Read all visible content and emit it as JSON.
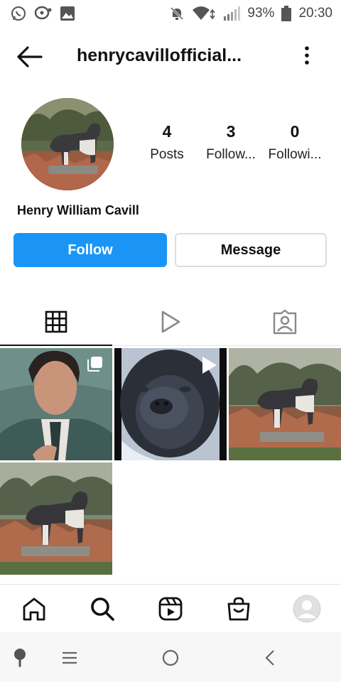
{
  "status_bar": {
    "battery": "93%",
    "time": "20:30",
    "left_icons": [
      "whatsapp-icon",
      "chat-bubble-icon",
      "image-icon"
    ],
    "right_icons": [
      "notifications-off-icon",
      "wifi-icon",
      "signal-icon",
      "battery-icon"
    ]
  },
  "header": {
    "username": "henrycavillofficial...",
    "back_icon": "arrow-left-icon",
    "more_icon": "more-vertical-icon"
  },
  "profile": {
    "display_name": "Henry William Cavill",
    "stats": [
      {
        "value": "4",
        "label": "Posts"
      },
      {
        "value": "3",
        "label": "Follow..."
      },
      {
        "value": "0",
        "label": "Followi..."
      }
    ]
  },
  "actions": {
    "follow_label": "Follow",
    "message_label": "Message"
  },
  "colors": {
    "follow_button": "#1a95f5",
    "active_tab": "#111111"
  },
  "tabs": [
    {
      "icon": "grid-icon",
      "active": true
    },
    {
      "icon": "reels-play-icon",
      "active": false
    },
    {
      "icon": "tagged-person-icon",
      "active": false
    }
  ],
  "posts": [
    {
      "subject": "man in suit portrait",
      "badge": "carousel-icon"
    },
    {
      "subject": "close-up dog face",
      "badge": "video-play-icon"
    },
    {
      "subject": "dog standing on bricks",
      "badge": ""
    },
    {
      "subject": "dog standing on bricks",
      "badge": ""
    }
  ],
  "bottom_nav": [
    "home-icon",
    "search-icon",
    "reels-icon",
    "shop-icon",
    "profile-avatar-icon"
  ],
  "system_nav": [
    "assistant-icon",
    "recent-apps-icon",
    "home-circle-icon",
    "back-chevron-icon"
  ]
}
